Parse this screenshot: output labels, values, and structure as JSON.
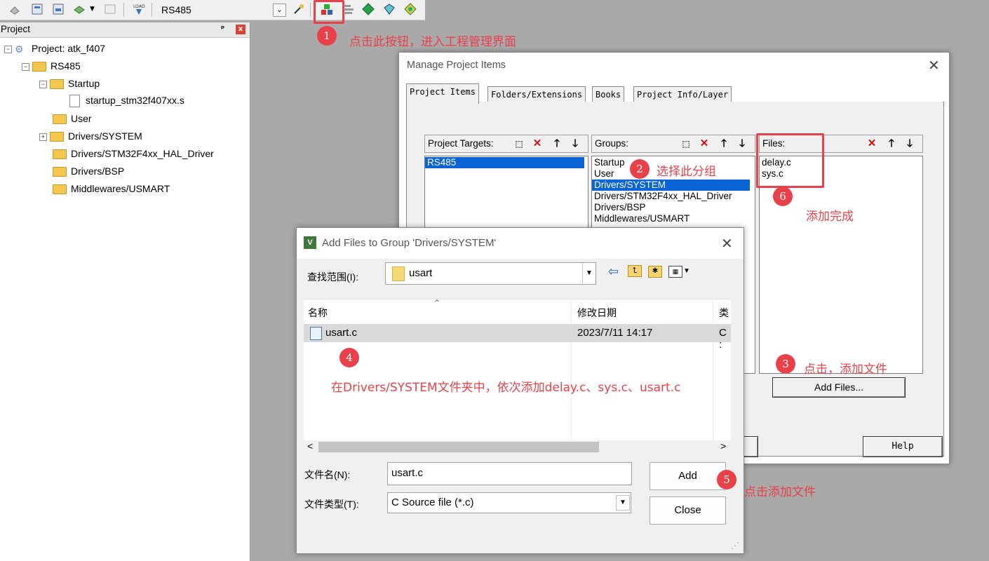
{
  "toolbar": {
    "target_value": "RS485"
  },
  "project_pane": {
    "title": "Project",
    "pin": "ᵖ",
    "close": "x",
    "tree": [
      {
        "label": "Project: atk_f407"
      },
      {
        "label": "RS485"
      },
      {
        "label": "Startup"
      },
      {
        "label": "startup_stm32f407xx.s"
      },
      {
        "label": "User"
      },
      {
        "label": "Drivers/SYSTEM"
      },
      {
        "label": "Drivers/STM32F4xx_HAL_Driver"
      },
      {
        "label": "Drivers/BSP"
      },
      {
        "label": "Middlewares/USMART"
      }
    ]
  },
  "manage_dialog": {
    "title": "Manage Project Items",
    "tabs": [
      "Project Items",
      "Folders/Extensions",
      "Books",
      "Project Info/Layer"
    ],
    "targets_label": "Project Targets:",
    "targets": [
      "RS485"
    ],
    "groups_label": "Groups:",
    "groups": [
      "Startup",
      "User",
      "Drivers/SYSTEM",
      "Drivers/STM32F4xx_HAL_Driver",
      "Drivers/BSP",
      "Middlewares/USMART"
    ],
    "files_label": "Files:",
    "files": [
      "delay.c",
      "sys.c"
    ],
    "add_files_button": "Add Files...",
    "help_button": "Help"
  },
  "add_dialog": {
    "title": "Add Files to Group 'Drivers/SYSTEM'",
    "look_in_label": "查找范围(I):",
    "look_in_value": "usart",
    "columns": [
      "名称",
      "修改日期",
      "类"
    ],
    "rows": [
      {
        "name": "usart.c",
        "date": "2023/7/11 14:17",
        "type": "C :"
      }
    ],
    "filename_label": "文件名(N):",
    "filename_value": "usart.c",
    "filetype_label": "文件类型(T):",
    "filetype_value": "C Source file (*.c)",
    "add_button": "Add",
    "close_button": "Close",
    "scroll_left": "<",
    "scroll_right": ">"
  },
  "annotations": {
    "n1": "1",
    "t1": "点击此按钮，进入工程管理界面",
    "n2": "2",
    "t2": "选择此分组",
    "n3": "3",
    "t3": "点击，添加文件",
    "n4": "4",
    "t4": "在Drivers/SYSTEM文件夹中，依次添加delay.c、sys.c、usart.c",
    "n5": "5",
    "t5": "点击添加文件",
    "n6": "6",
    "t6": "添加完成"
  },
  "colors": {
    "annotation": "#e8414a",
    "selection": "#0a64d8",
    "folder": "#f3c74d"
  }
}
